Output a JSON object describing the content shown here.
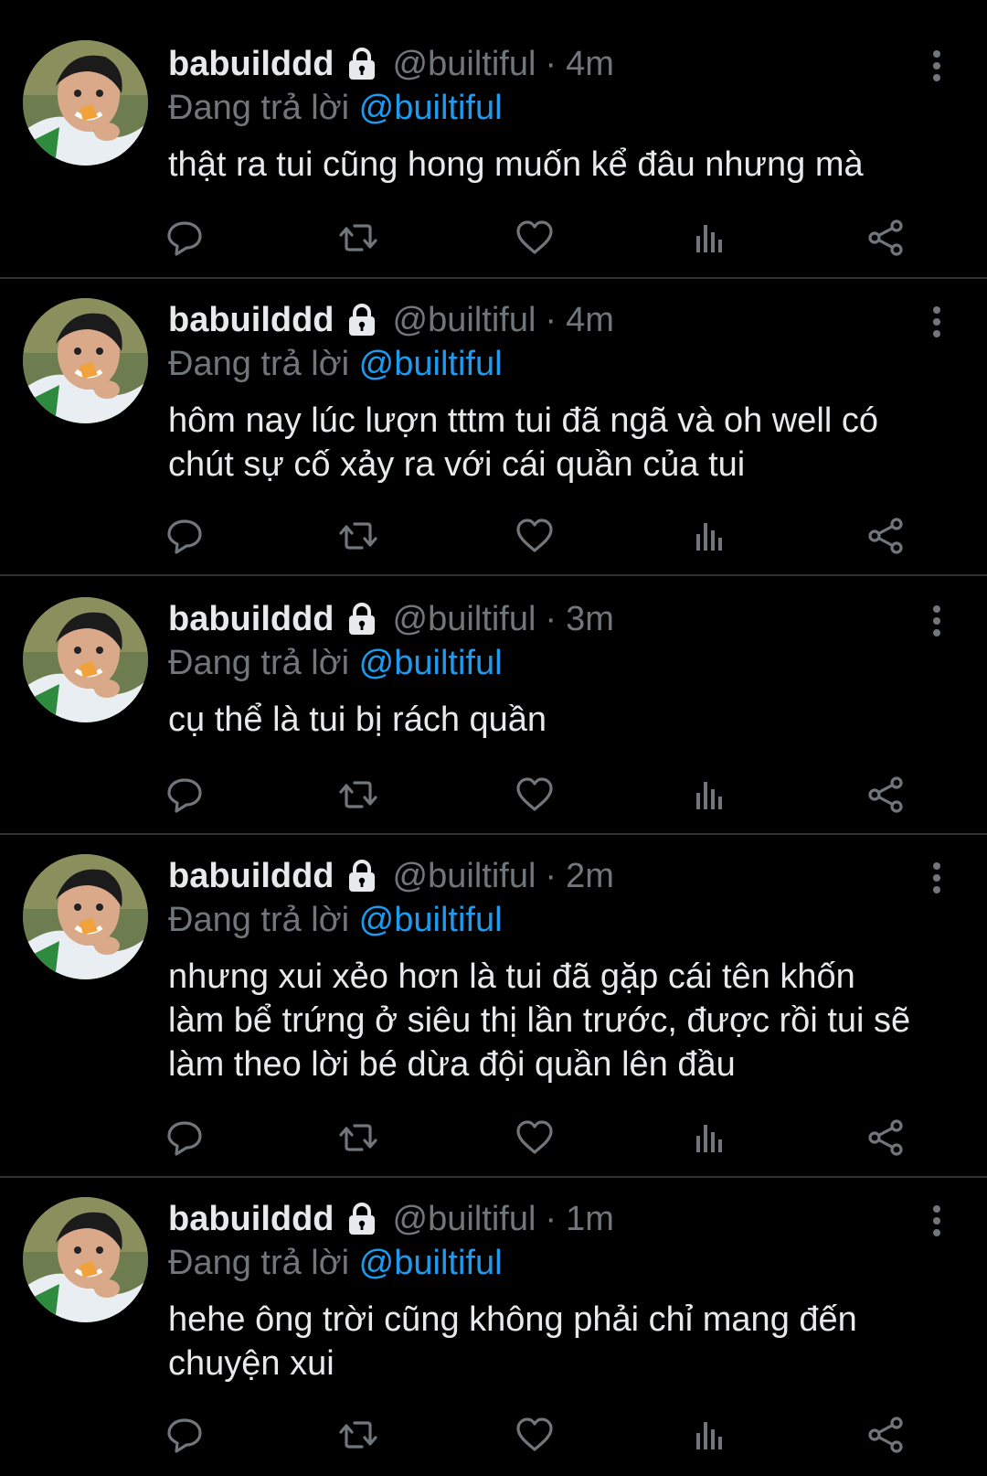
{
  "colors": {
    "background": "#000000",
    "text": "#e7e9ea",
    "secondary": "#71767b",
    "accent": "#1d9bf0",
    "divider": "#2f3336"
  },
  "icons": {
    "lock": "lock-icon",
    "more": "more-vertical-icon",
    "reply": "reply-icon",
    "retweet": "retweet-icon",
    "like": "heart-icon",
    "analytics": "analytics-icon",
    "share": "share-icon"
  },
  "tweets": [
    {
      "display_name": "babuilddd",
      "handle": "@builtiful",
      "separator": "·",
      "time": "4m",
      "reply_prefix": "Đang trả lời",
      "reply_to": "@builtiful",
      "text": "thật ra tui cũng hong muốn kể đâu nhưng mà"
    },
    {
      "display_name": "babuilddd",
      "handle": "@builtiful",
      "separator": "·",
      "time": "4m",
      "reply_prefix": "Đang trả lời",
      "reply_to": "@builtiful",
      "text": "hôm nay lúc lượn tttm tui đã ngã và oh well có\nchút sự cố xảy ra với cái quần của tui"
    },
    {
      "display_name": "babuilddd",
      "handle": "@builtiful",
      "separator": "·",
      "time": "3m",
      "reply_prefix": "Đang trả lời",
      "reply_to": "@builtiful",
      "text": "cụ thể là tui bị rách quần"
    },
    {
      "display_name": "babuilddd",
      "handle": "@builtiful",
      "separator": "·",
      "time": "2m",
      "reply_prefix": "Đang trả lời",
      "reply_to": "@builtiful",
      "text": "nhưng xui xẻo hơn là tui đã gặp cái tên khốn\nlàm bể trứng ở siêu thị lần trước, được rồi tui sẽ\nlàm theo lời bé dừa đội quần lên đầu"
    },
    {
      "display_name": "babuilddd",
      "handle": "@builtiful",
      "separator": "·",
      "time": "1m",
      "reply_prefix": "Đang trả lời",
      "reply_to": "@builtiful",
      "text": "hehe ông trời cũng không phải chỉ mang đến\nchuyện xui"
    }
  ]
}
